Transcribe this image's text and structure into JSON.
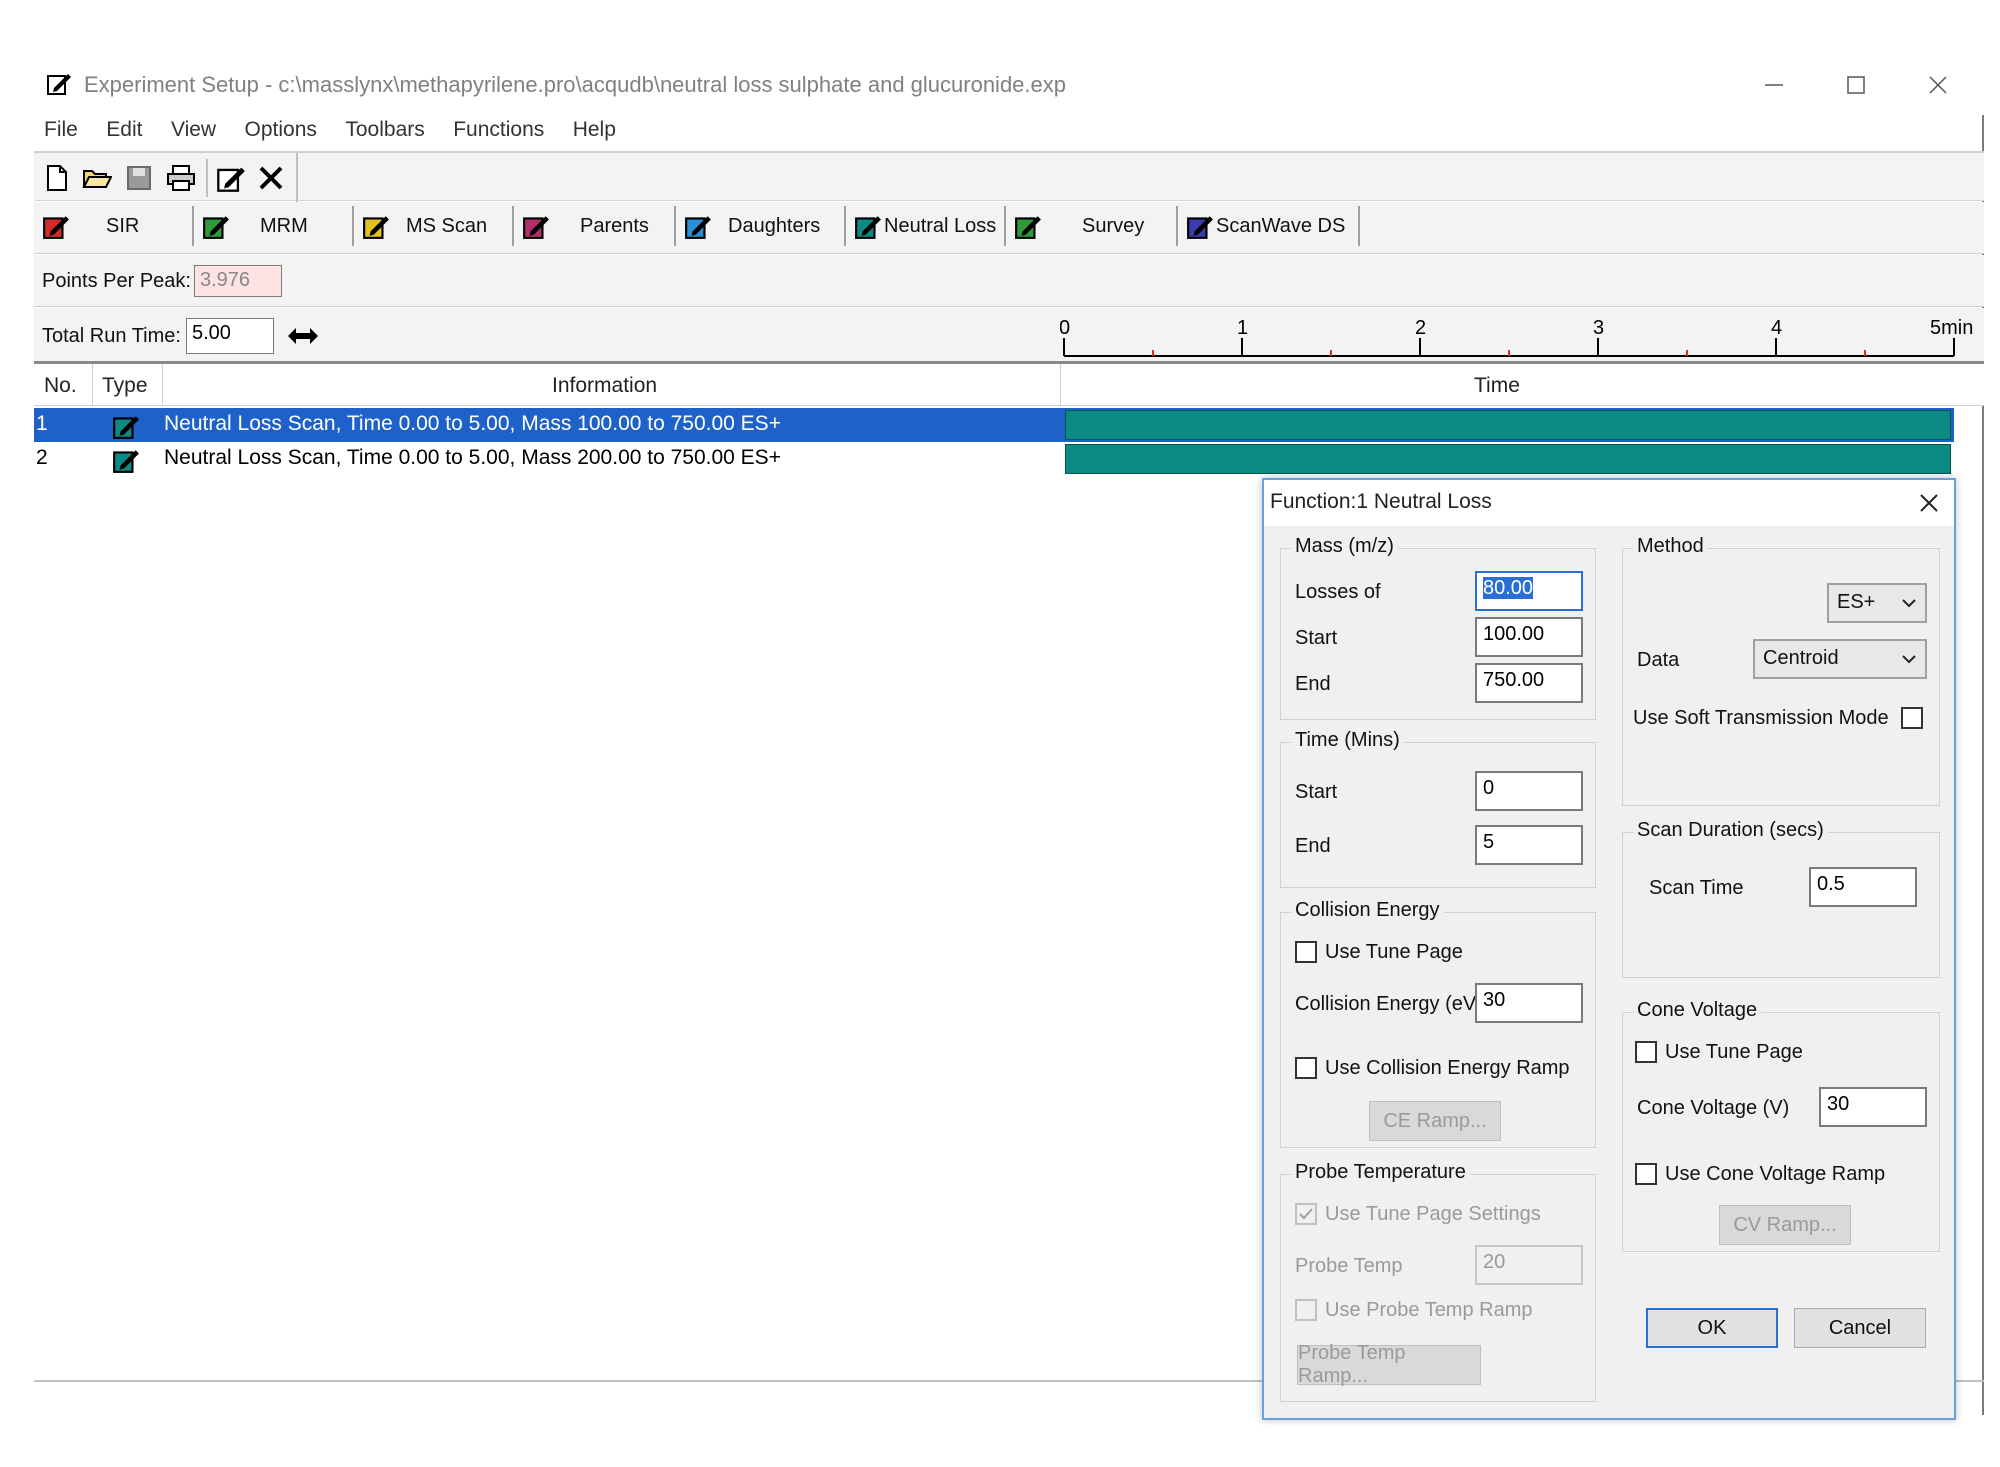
{
  "window": {
    "title": "Experiment Setup - c:\\masslynx\\methapyrilene.pro\\acqudb\\neutral loss sulphate and glucuronide.exp"
  },
  "menu": [
    "File",
    "Edit",
    "View",
    "Options",
    "Toolbars",
    "Functions",
    "Help"
  ],
  "function_buttons": [
    {
      "label": "SIR",
      "color": "#d42a2a"
    },
    {
      "label": "MRM",
      "color": "#2e9b3a"
    },
    {
      "label": "MS Scan",
      "color": "#e3c21b"
    },
    {
      "label": "Parents",
      "color": "#b0306e"
    },
    {
      "label": "Daughters",
      "color": "#2a8fd4"
    },
    {
      "label": "Neutral Loss",
      "color": "#0c8a83"
    },
    {
      "label": "Survey",
      "color": "#2e9b3a"
    },
    {
      "label": "ScanWave DS",
      "color": "#3b3bb0"
    }
  ],
  "points_per_peak": {
    "label": "Points Per Peak:",
    "value": "3.976"
  },
  "total_run_time": {
    "label": "Total Run Time:",
    "value": "5.00"
  },
  "timeline": {
    "ticks": [
      "0",
      "1",
      "2",
      "3",
      "4",
      "5min"
    ],
    "max": 5
  },
  "table": {
    "headers": {
      "no": "No.",
      "type": "Type",
      "information": "Information",
      "time": "Time"
    },
    "rows": [
      {
        "no": "1",
        "info": "Neutral Loss Scan, Time 0.00 to 5.00, Mass 100.00 to 750.00 ES+",
        "start": 0,
        "end": 5,
        "selected": true
      },
      {
        "no": "2",
        "info": "Neutral Loss Scan, Time 0.00 to 5.00, Mass 200.00 to 750.00 ES+",
        "start": 0,
        "end": 5,
        "selected": false
      }
    ]
  },
  "dialog": {
    "title": "Function:1 Neutral Loss",
    "mass": {
      "title": "Mass (m/z)",
      "losses_label": "Losses of",
      "losses_value": "80.00",
      "start_label": "Start",
      "start_value": "100.00",
      "end_label": "End",
      "end_value": "750.00"
    },
    "time": {
      "title": "Time (Mins)",
      "start_label": "Start",
      "start_value": "0",
      "end_label": "End",
      "end_value": "5"
    },
    "collision": {
      "title": "Collision Energy",
      "use_tune_page": "Use Tune Page",
      "energy_label": "Collision Energy (eV)",
      "energy_value": "30",
      "use_ramp": "Use Collision Energy Ramp",
      "ramp_button": "CE Ramp..."
    },
    "probe": {
      "title": "Probe Temperature",
      "use_tune_settings": "Use Tune Page Settings",
      "temp_label": "Probe Temp",
      "temp_value": "20",
      "use_ramp": "Use Probe Temp Ramp",
      "ramp_button": "Probe Temp Ramp..."
    },
    "method": {
      "title": "Method",
      "polarity": "ES+",
      "data_label": "Data",
      "data_value": "Centroid",
      "soft_transmission": "Use Soft Transmission Mode"
    },
    "scan_duration": {
      "title": "Scan Duration (secs)",
      "scan_time_label": "Scan Time",
      "scan_time_value": "0.5"
    },
    "cone": {
      "title": "Cone Voltage",
      "use_tune_page": "Use Tune Page",
      "voltage_label": "Cone Voltage (V)",
      "voltage_value": "30",
      "use_ramp": "Use Cone Voltage Ramp",
      "ramp_button": "CV Ramp..."
    },
    "ok": "OK",
    "cancel": "Cancel"
  }
}
